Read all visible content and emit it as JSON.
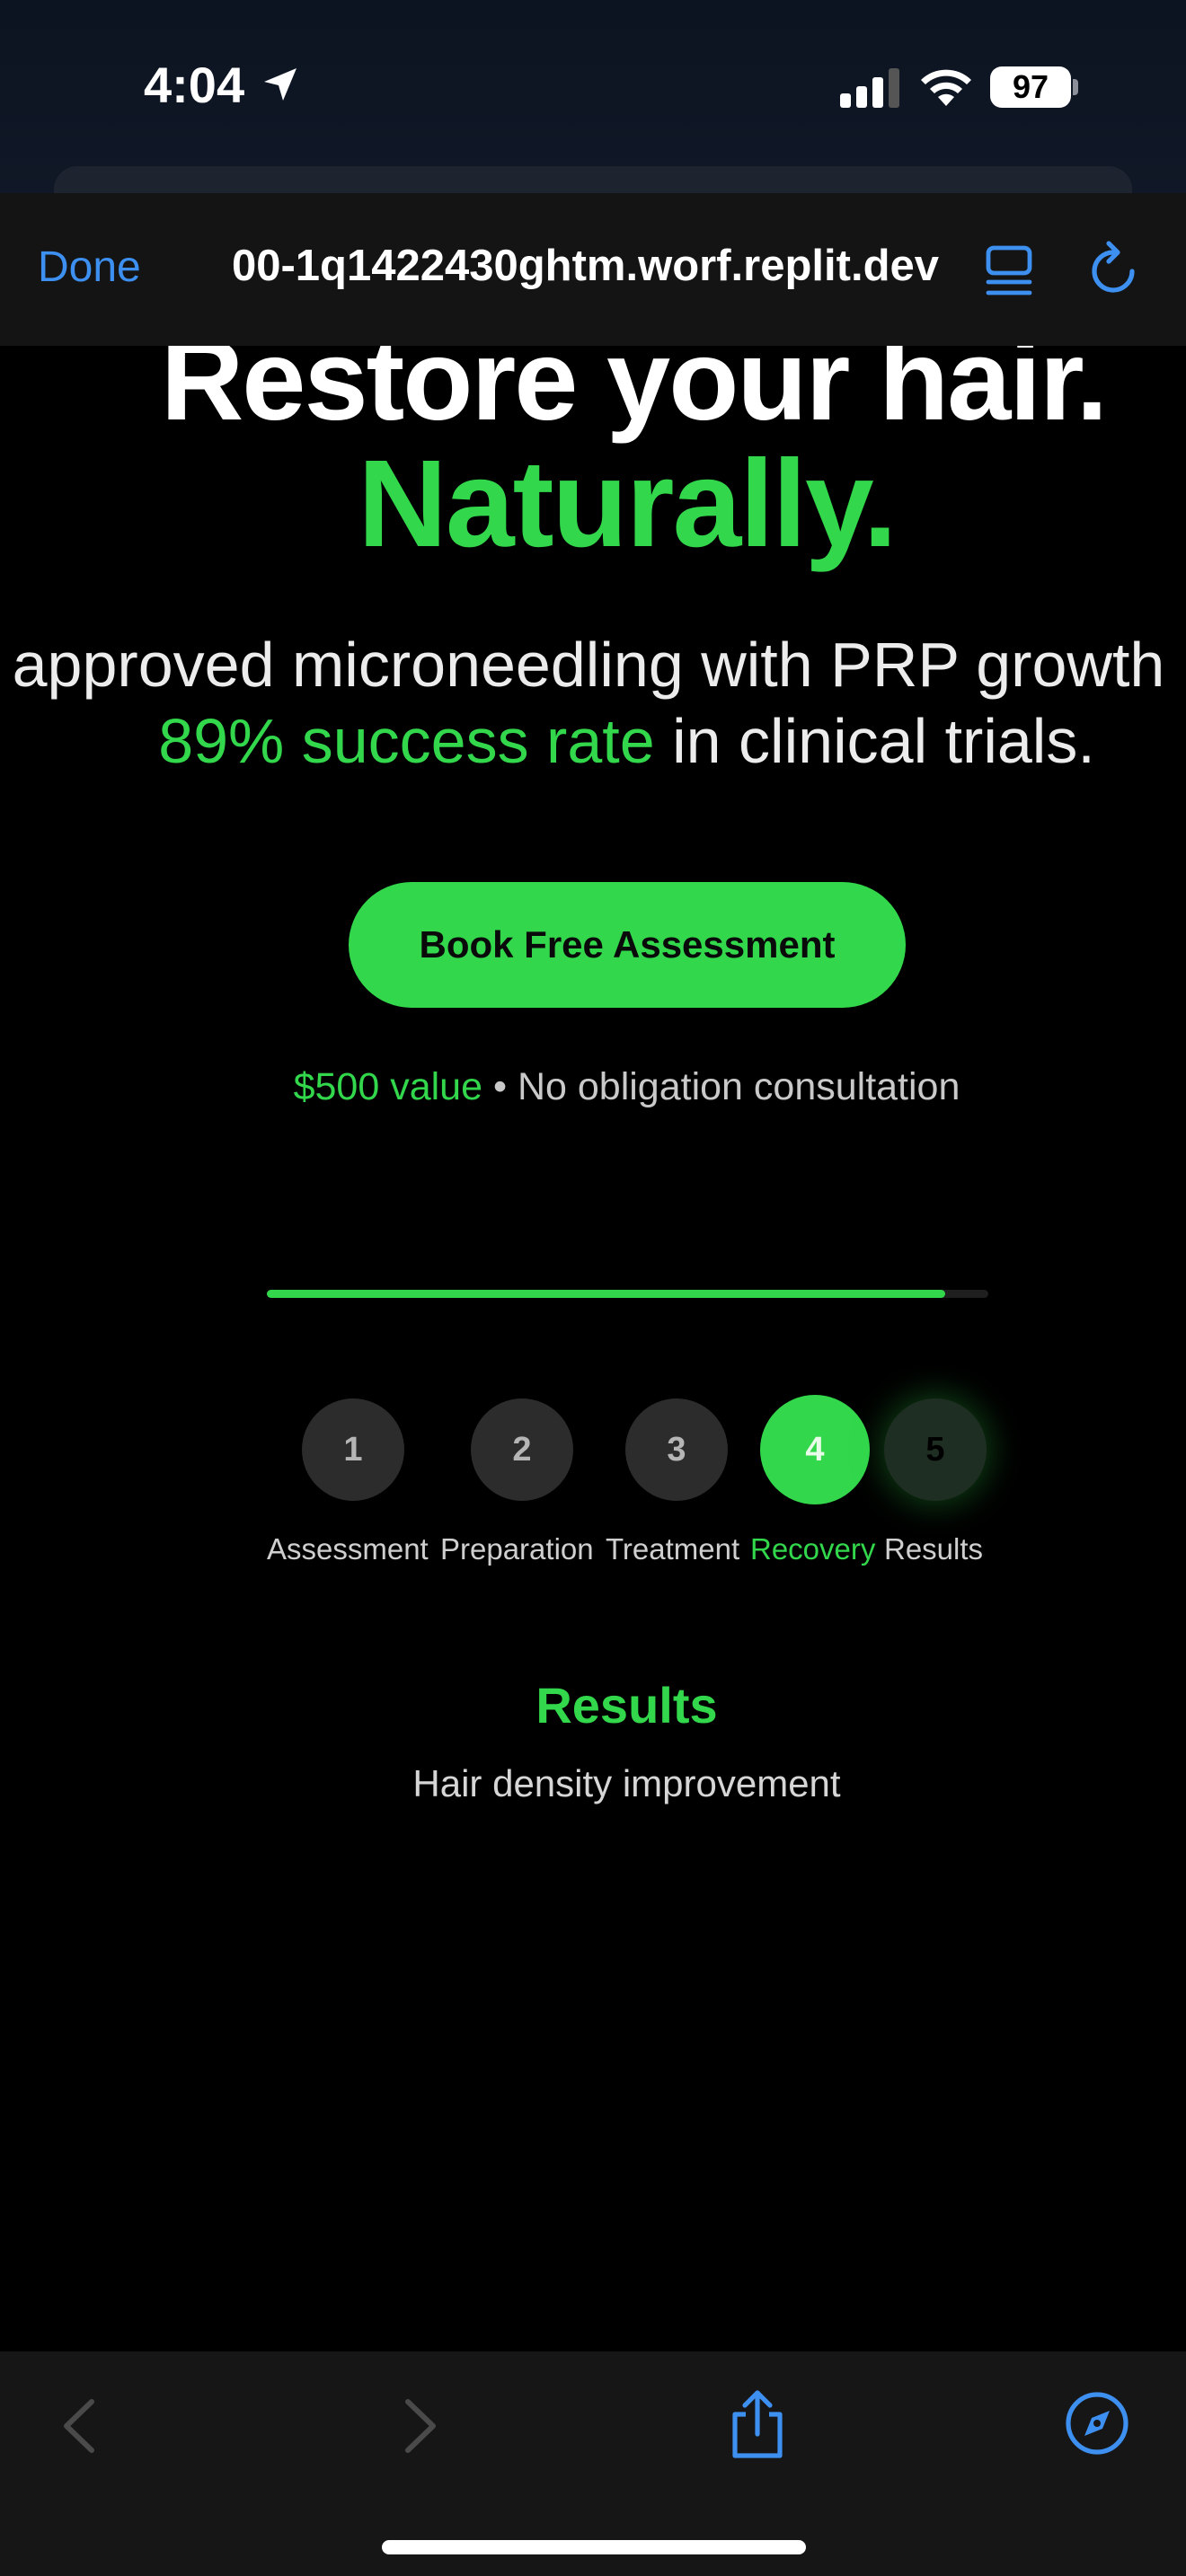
{
  "status_bar": {
    "time": "4:04",
    "battery_level": "97",
    "icons": [
      "location-arrow-icon",
      "cellular-signal-icon",
      "wifi-icon",
      "battery-icon"
    ]
  },
  "browser": {
    "done_label": "Done",
    "url": "00-1q1422430ghtm.worf.replit.dev",
    "icons": [
      "reader-view-icon",
      "reload-icon",
      "back-arrow-icon",
      "forward-arrow-icon",
      "share-icon",
      "compass-icon"
    ]
  },
  "hero": {
    "title": "Restore your hair.",
    "title_accent": "Naturally.",
    "subtitle_line1": "approved microneedling with PRP growth",
    "subtitle_highlight": "89% success rate",
    "subtitle_rest": " in clinical trials.",
    "cta_label": "Book Free Assessment",
    "value_highlight": "$500 value",
    "value_rest": " • No obligation consultation"
  },
  "progress": {
    "fill_fraction": 0.94
  },
  "steps": [
    {
      "number": "1",
      "label": "Assessment",
      "state": "default"
    },
    {
      "number": "2",
      "label": "Preparation",
      "state": "default"
    },
    {
      "number": "3",
      "label": "Treatment",
      "state": "default"
    },
    {
      "number": "4",
      "label": "Recovery",
      "state": "active"
    },
    {
      "number": "5",
      "label": "Results",
      "state": "next"
    }
  ],
  "results": {
    "title": "Results",
    "description": "Hair density improvement"
  },
  "colors": {
    "accent": "#32d74b",
    "link_blue": "#3d8ff0",
    "background": "#000000"
  }
}
